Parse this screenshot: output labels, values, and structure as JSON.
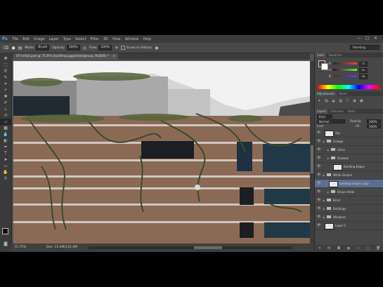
{
  "app": {
    "logo": "Ps"
  },
  "menu": [
    "File",
    "Edit",
    "Image",
    "Layer",
    "Type",
    "Select",
    "Filter",
    "3D",
    "View",
    "Window",
    "Help"
  ],
  "window_controls": {
    "minimize": "—",
    "maximize": "□",
    "close": "✕"
  },
  "options_bar": {
    "mode_label": "Mode:",
    "mode_value": "Brush",
    "opacity_label": "Opacity:",
    "opacity_value": "100%",
    "flow_label": "Flow:",
    "flow_value": "100%",
    "erase_history_label": "Erase to History",
    "workspace": "Painting"
  },
  "document_tab": {
    "title": "07 Initial.psd @ 75.8% (building.jpg/photo/group, RGB/8) *",
    "close": "×"
  },
  "status_bar": {
    "zoom": "75.75%",
    "doc": "Doc: 11.4M/133.4M"
  },
  "panels": {
    "color_tabs": [
      "Color",
      "Swatches"
    ],
    "color_sliders": [
      {
        "label": "R",
        "value": "75"
      },
      {
        "label": "G",
        "value": "61"
      },
      {
        "label": "B",
        "value": "48"
      }
    ],
    "adjust_tabs": [
      "Adjustments",
      "Styles"
    ],
    "layers_tabs": [
      "Layers",
      "Channels",
      "Paths"
    ],
    "kind_label": "Kind",
    "blend_mode": "Normal",
    "opacity_label": "Opacity:",
    "opacity_value": "100%",
    "lock_label": "Lock:",
    "fill_label": "Fill:",
    "fill_value": "100%",
    "layers": [
      {
        "name": "Sky",
        "type": "layer",
        "indent": 0,
        "selected": false
      },
      {
        "name": "Foliage",
        "type": "group",
        "indent": 0,
        "selected": false
      },
      {
        "name": "Vines",
        "type": "group",
        "indent": 1,
        "selected": false
      },
      {
        "name": "Shadow",
        "type": "group",
        "indent": 1,
        "selected": false
      },
      {
        "name": "Building Edges",
        "type": "layer",
        "indent": 2,
        "selected": false
      },
      {
        "name": "White Stripes",
        "type": "group",
        "indent": 0,
        "selected": false
      },
      {
        "name": "building-stripes copy",
        "type": "layer",
        "indent": 1,
        "selected": true
      },
      {
        "name": "Stripe detail",
        "type": "group",
        "indent": 1,
        "selected": false
      },
      {
        "name": "Brick",
        "type": "group",
        "indent": 0,
        "selected": false
      },
      {
        "name": "Buildings",
        "type": "group",
        "indent": 0,
        "selected": false
      },
      {
        "name": "Windows",
        "type": "group",
        "indent": 0,
        "selected": false
      },
      {
        "name": "Layer 0",
        "type": "layer",
        "indent": 0,
        "selected": false
      }
    ]
  },
  "toolbox": [
    "move-icon",
    "marquee-icon",
    "lasso-icon",
    "quick-select-icon",
    "crop-icon",
    "eyedropper-icon",
    "healing-icon",
    "brush-icon",
    "stamp-icon",
    "history-brush-icon",
    "eraser-icon",
    "gradient-icon",
    "blur-icon",
    "dodge-icon",
    "pen-icon",
    "type-icon",
    "path-select-icon",
    "shape-icon",
    "hand-icon",
    "zoom-icon"
  ]
}
